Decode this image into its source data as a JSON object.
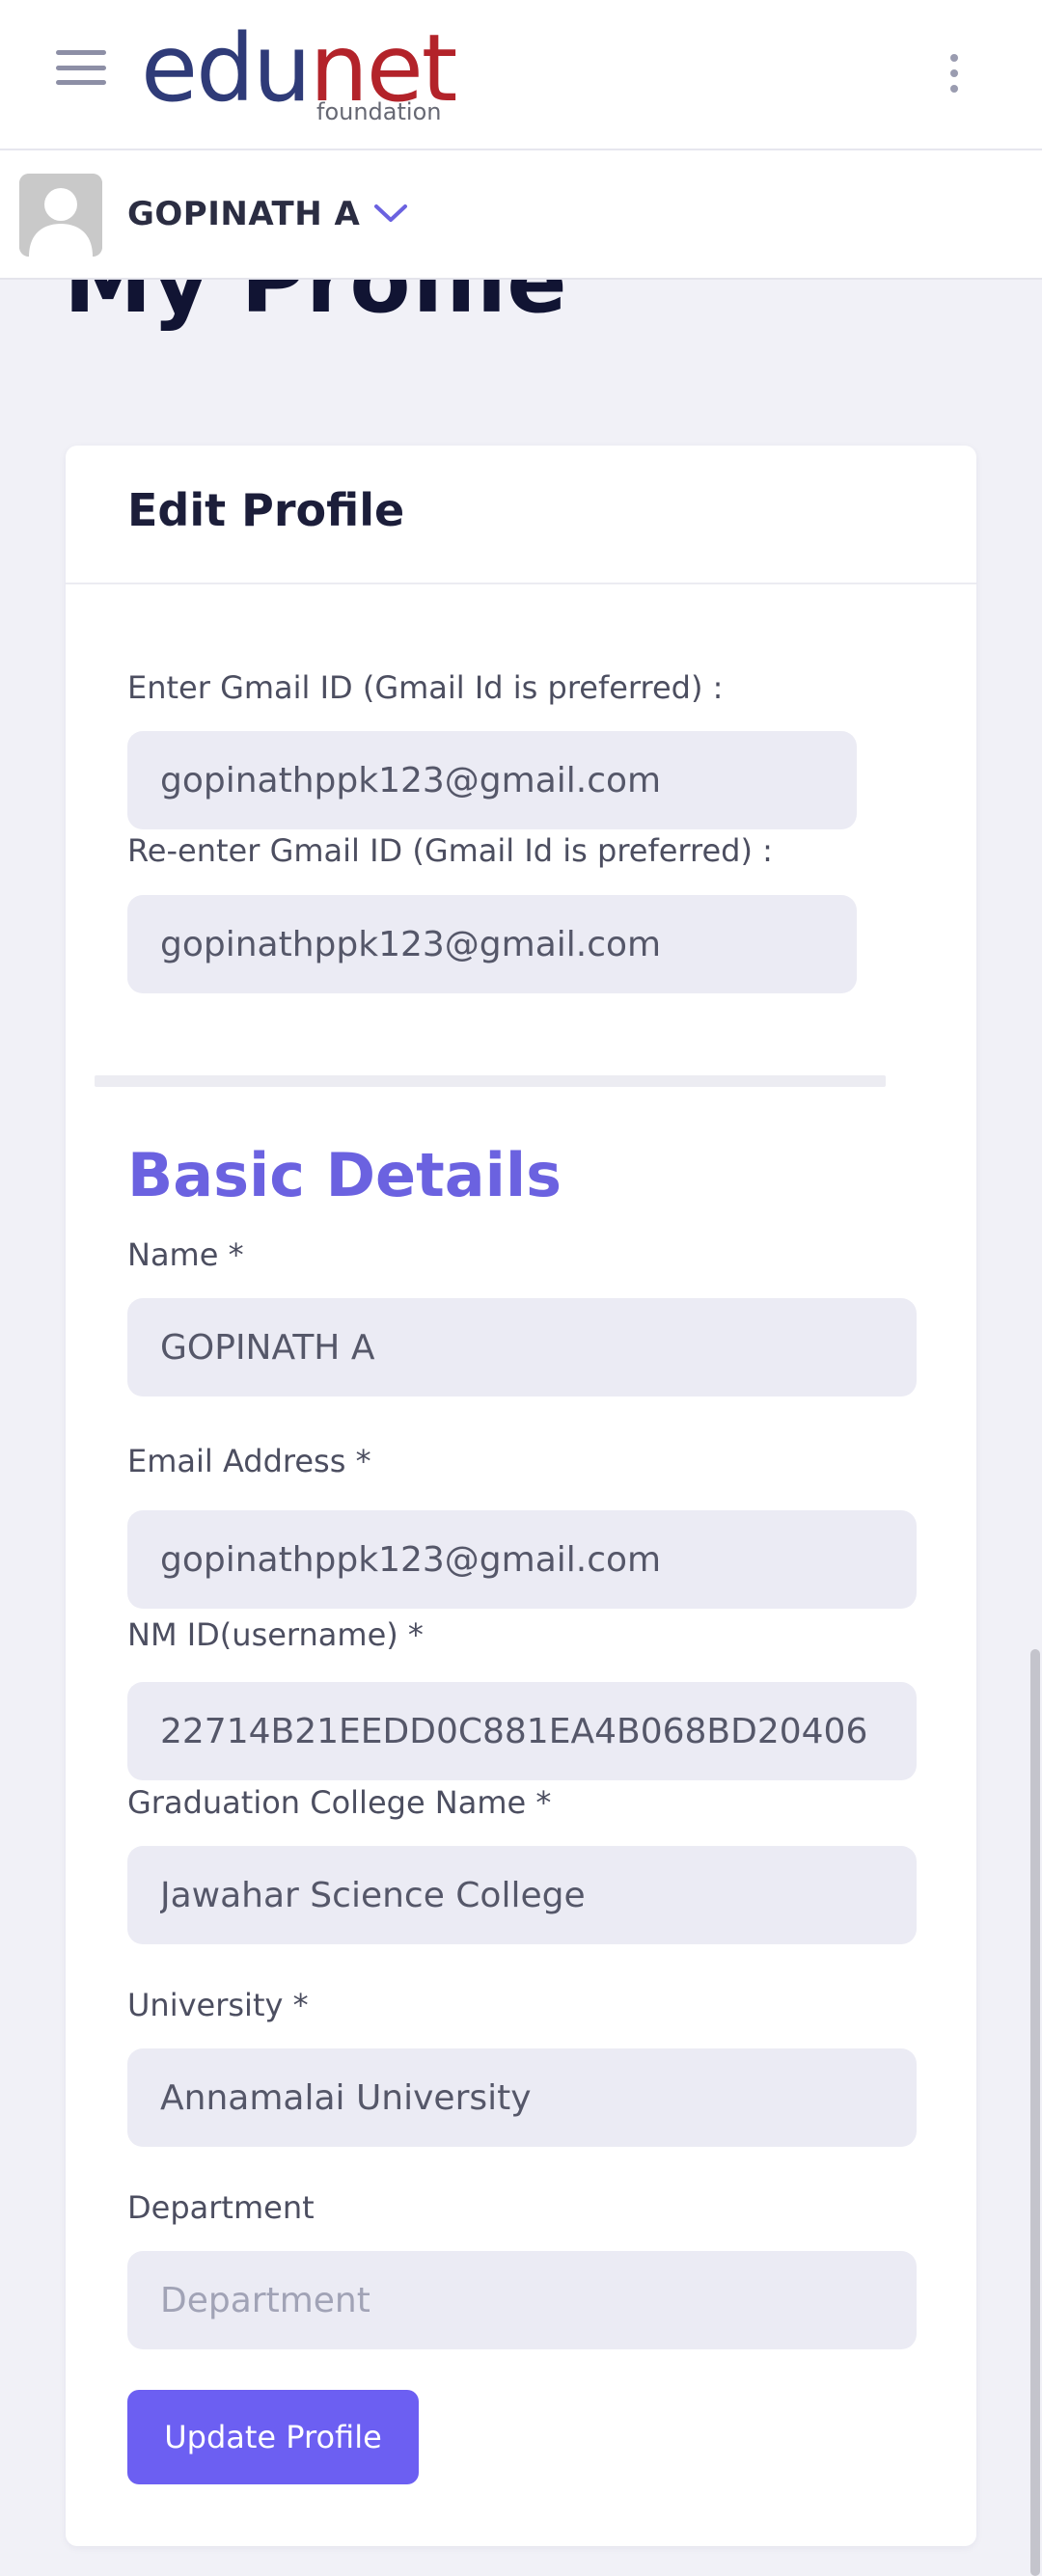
{
  "header": {
    "logo_main_1": "edu",
    "logo_main_2": "net",
    "logo_sub": "foundation",
    "menu_icon": "hamburger-menu-icon",
    "more_icon": "kebab-more-icon"
  },
  "user": {
    "name": "GOPINATH A",
    "avatar_icon": "default-avatar-icon",
    "caret_icon": "chevron-down-icon"
  },
  "page": {
    "title": "My Profile"
  },
  "card": {
    "title": "Edit Profile"
  },
  "gmail": {
    "label": "Enter Gmail ID (Gmail Id is preferred) :",
    "value": "gopinathppk123@gmail.com",
    "reenter_label": "Re-enter Gmail ID (Gmail Id is preferred) :",
    "reenter_value": "gopinathppk123@gmail.com"
  },
  "basic": {
    "section_title": "Basic Details",
    "name_label": "Name *",
    "name_value": "GOPINATH A",
    "email_label": "Email Address *",
    "email_value": "gopinathppk123@gmail.com",
    "nmid_label": "NM ID(username) *",
    "nmid_value": "22714B21EEDD0C881EA4B068BD20406",
    "college_label": "Graduation College Name *",
    "college_value": "Jawahar Science College",
    "university_label": "University *",
    "university_value": "Annamalai University",
    "department_label": "Department",
    "department_value": "",
    "department_placeholder": "Department"
  },
  "actions": {
    "update_label": "Update Profile"
  },
  "colors": {
    "accent": "#6c5ff2",
    "section_title": "#6b62e0",
    "logo_edu": "#2f3b78",
    "logo_net": "#b3232a",
    "input_bg": "#ebebf4",
    "page_bg": "#f1f1f7"
  }
}
